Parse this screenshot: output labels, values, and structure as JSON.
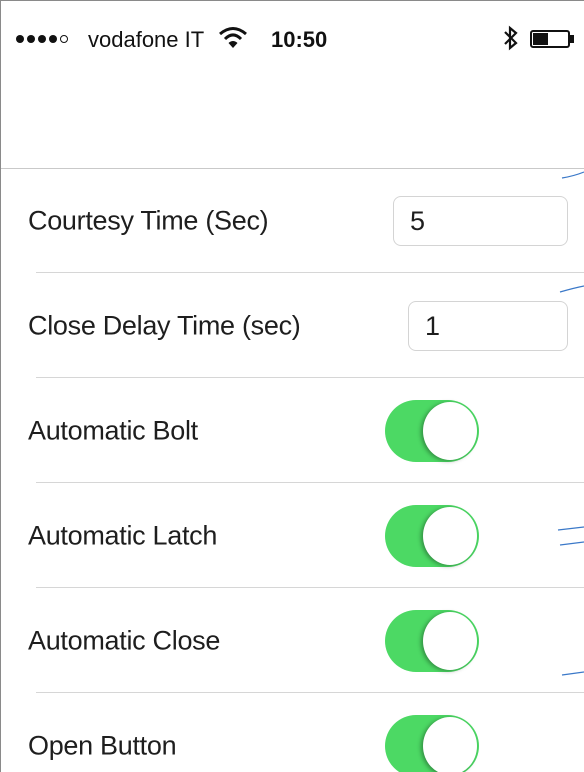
{
  "status_bar": {
    "carrier": "vodafone IT",
    "time": "10:50",
    "signal_bars_filled": 4,
    "signal_bars_total": 5,
    "icons": [
      "signal-dots-icon",
      "wifi-icon",
      "bluetooth-icon",
      "battery-icon"
    ],
    "battery_level": 0.4
  },
  "settings": {
    "courtesy_time": {
      "label": "Courtesy Time (Sec)",
      "value": "5"
    },
    "close_delay_time": {
      "label": "Close Delay Time (sec)",
      "value": "1"
    },
    "automatic_bolt": {
      "label": "Automatic Bolt",
      "on": true
    },
    "automatic_latch": {
      "label": "Automatic Latch",
      "on": true
    },
    "automatic_close": {
      "label": "Automatic Close",
      "on": true
    },
    "open_button": {
      "label": "Open Button",
      "on": true
    }
  },
  "colors": {
    "toggle_on": "#4cd964",
    "separator": "#d6d6d6",
    "text": "#1e1e1e"
  }
}
